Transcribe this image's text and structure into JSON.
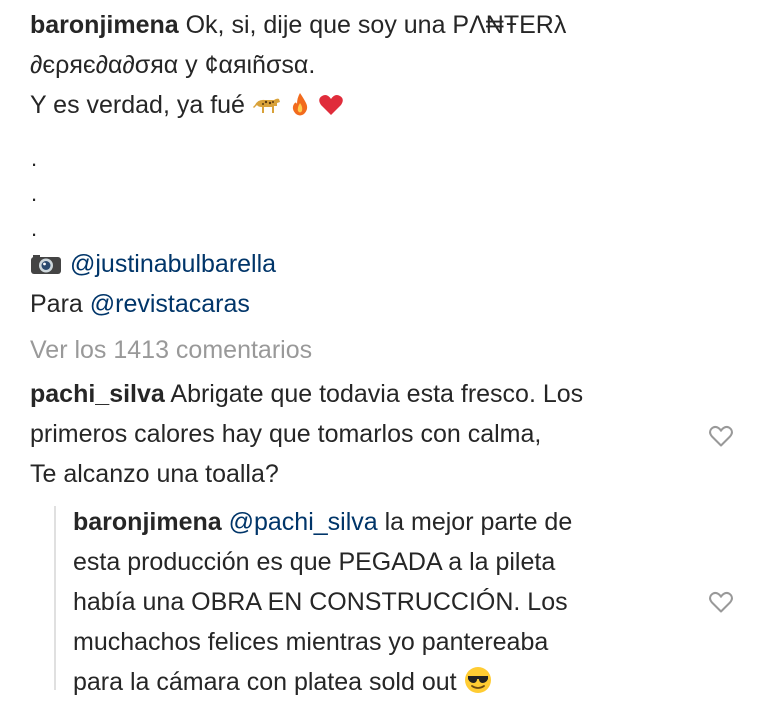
{
  "caption": {
    "username": "baronjimena",
    "line1": "Ok, si, dije que soy una PΛ₦ŦERλ",
    "line2": "∂єρяє∂α∂σяα у ¢αяιñσѕα.",
    "line3": "Y es verdad, ya fué",
    "emoji_names": [
      "leopard-emoji",
      "fire-emoji",
      "red-heart-emoji"
    ],
    "dots": [
      ".",
      ".",
      "."
    ],
    "credit_handle": "@justinabulbarella",
    "credit_icon": "camera-icon",
    "para_prefix": "Para",
    "para_handle": "@revistacaras"
  },
  "view_all_comments": "Ver los 1413 comentarios",
  "comments": [
    {
      "username": "pachi_silva",
      "lines": [
        "Abrigate que todavia esta fresco. Los",
        "primeros calores hay que tomarlos con calma,",
        "Te alcanzo una toalla?"
      ],
      "like_icon": "heart-outline-icon"
    }
  ],
  "reply": {
    "username": "baronjimena",
    "mention": "@pachi_silva",
    "lines": [
      "la mejor parte de",
      "esta producción es que PEGADA a la pileta",
      "había una OBRA EN CONSTRUCCIÓN. Los",
      "muchachos felices mientras yo pantereaba",
      "para la cámara con platea sold out"
    ],
    "emoji_name": "sunglasses-emoji",
    "like_icon": "heart-outline-icon"
  },
  "colors": {
    "text": "#262626",
    "mention": "#003569",
    "muted": "#999999",
    "heart_outline": "#999999"
  }
}
